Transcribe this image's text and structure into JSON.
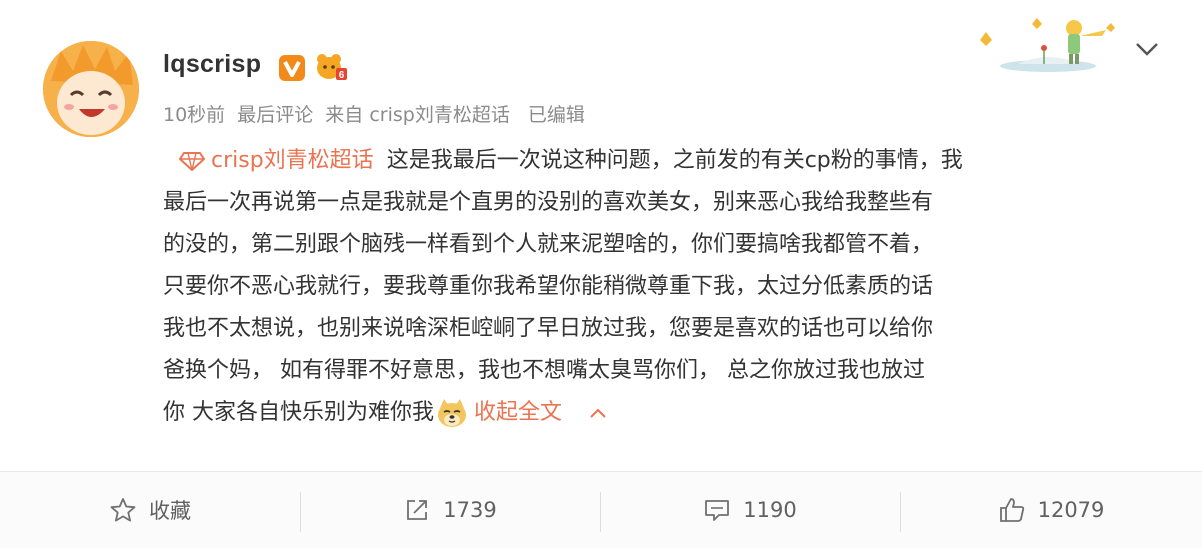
{
  "post": {
    "username": "lqscrisp",
    "meta": {
      "time": "10秒前",
      "last_comment": "最后评论",
      "source": "来自 crisp刘青松超话",
      "edited": "已编辑"
    },
    "topic": "crisp刘青松超话",
    "lines": [
      "这是我最后一次说这种问题，之前发的有关cp粉的事情，我",
      "最后一次再说第一点是我就是个直男的没别的喜欢美女，别来恶心我给我整些有",
      "的没的，第二别跟个脑残一样看到个人就来泥塑啥的，你们要搞啥我都管不着，",
      "只要你不恶心我就行，要我尊重你我希望你能稍微尊重下我，太过分低素质的话",
      "我也不太想说，也别来说啥深柜崆峒了早日放过我，您要是喜欢的话也可以给你",
      "爸换个妈，   如有得罪不好意思，我也不想嘴太臭骂你们， 总之你放过我也放过",
      "你 大家各自快乐别为难你我"
    ],
    "collapse_label": "收起全文",
    "emoji": "doge-emoji"
  },
  "actions": {
    "favorite": "收藏",
    "repost": "1739",
    "comment": "1190",
    "like": "12079"
  },
  "colors": {
    "topic": "#eb7350",
    "meta": "#8b8b8b",
    "text": "#333333"
  }
}
